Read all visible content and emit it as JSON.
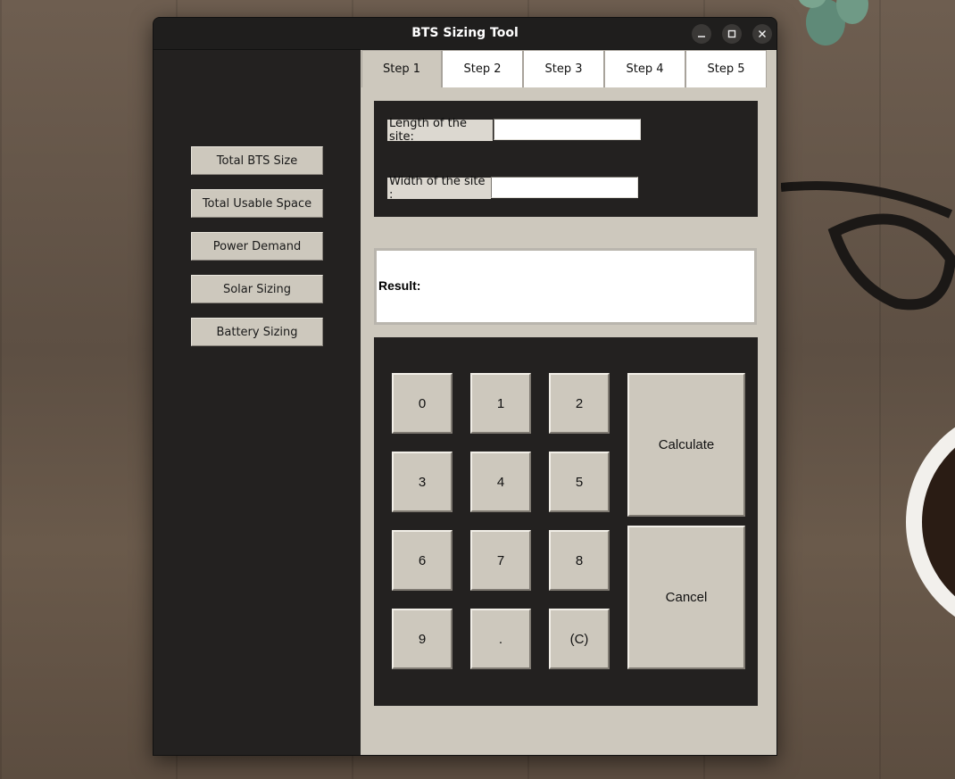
{
  "window": {
    "title": "BTS Sizing Tool",
    "controls": [
      "minimize",
      "maximize",
      "close"
    ]
  },
  "sidebar": {
    "items": [
      {
        "label": "Total BTS Size"
      },
      {
        "label": "Total Usable Space"
      },
      {
        "label": "Power Demand"
      },
      {
        "label": "Solar Sizing"
      },
      {
        "label": "Battery Sizing"
      }
    ]
  },
  "tabs": [
    {
      "label": "Step 1",
      "active": true
    },
    {
      "label": "Step 2",
      "active": false
    },
    {
      "label": "Step 3",
      "active": false
    },
    {
      "label": "Step 4",
      "active": false
    },
    {
      "label": "Step 5",
      "active": false
    }
  ],
  "form": {
    "length_label": "Length of the site:",
    "length_value": "",
    "width_label": "Width of the site :",
    "width_value": ""
  },
  "result": {
    "label": "Result:"
  },
  "keypad": {
    "keys": [
      "0",
      "1",
      "2",
      "3",
      "4",
      "5",
      "6",
      "7",
      "8",
      "9",
      ".",
      "(C)"
    ],
    "calculate_label": "Calculate",
    "cancel_label": "Cancel"
  },
  "colors": {
    "dark_panel": "#232120",
    "button_face": "#cdc8bd",
    "content_bg": "#cdc8bd"
  }
}
